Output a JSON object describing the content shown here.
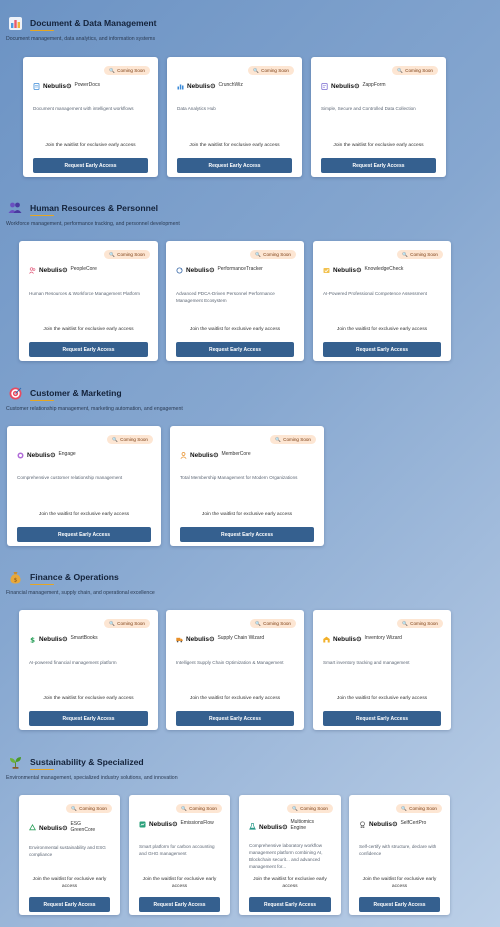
{
  "badge_label": "Coming Soon",
  "brand": "Nebulis⊙",
  "waitlist_text": "Join the waitlist for exclusive early access",
  "button_label": "Request Early Access",
  "sections": [
    {
      "title": "Document & Data Management",
      "subtitle": "Document management, data analytics, and information systems",
      "icon": "bar-chart-icon",
      "cards": [
        {
          "name": "PowerDocs",
          "icon": "document-icon",
          "description": "Document management with intelligent workflows"
        },
        {
          "name": "CrunchWiz",
          "icon": "analytics-icon",
          "description": "Data Analytics Hub"
        },
        {
          "name": "ZappForm",
          "icon": "form-icon",
          "description": "Simple, Secure and Controlled Data Collection"
        }
      ]
    },
    {
      "title": "Human Resources & Personnel",
      "subtitle": "Workforce management, performance tracking, and personnel development",
      "icon": "people-icon",
      "cards": [
        {
          "name": "PeopleCore",
          "icon": "people-icon",
          "description": "Human Resources & Workforce Management Platform"
        },
        {
          "name": "PerformanceTracker",
          "icon": "cycle-icon",
          "description": "Advanced PDCA-Driven Personnel Performance Management Ecosystem"
        },
        {
          "name": "KnowledgeCheck",
          "icon": "knowledge-icon",
          "description": "AI-Powered Professional Competence Assessment"
        }
      ]
    },
    {
      "title": "Customer & Marketing",
      "subtitle": "Customer relationship management, marketing automation, and engagement",
      "icon": "target-icon",
      "cards": [
        {
          "name": "Engage",
          "icon": "engage-icon",
          "description": "Comprehensive customer relationship management"
        },
        {
          "name": "MemberCore",
          "icon": "member-icon",
          "description": "Total Membership Management for Modern Organizations"
        }
      ]
    },
    {
      "title": "Finance & Operations",
      "subtitle": "Financial management, supply chain, and operational excellence",
      "icon": "money-bag-icon",
      "cards": [
        {
          "name": "SmartBooks",
          "icon": "dollar-icon",
          "description": "AI-powered financial management platform"
        },
        {
          "name": "Supply Chain Wizard",
          "icon": "truck-icon",
          "description": "Intelligent Supply Chain Optimization & Management"
        },
        {
          "name": "Inventory Wizard",
          "icon": "warehouse-icon",
          "description": "Smart inventory tracking and management"
        }
      ]
    },
    {
      "title": "Sustainability & Specialized",
      "subtitle": "Environmental management, specialized industry solutions, and innovation",
      "icon": "sprout-icon",
      "cards": [
        {
          "name": "ESG GreenCore",
          "icon": "recycle-icon",
          "description": "Environmental sustainability and ESG compliance"
        },
        {
          "name": "EmissionsFlow",
          "icon": "emissions-icon",
          "description": "Smart platform for carbon accounting and GHG management"
        },
        {
          "name": "Multiomics Engine",
          "icon": "lab-icon",
          "description": "Comprehensive laboratory workflow management platform combining AI, Blockchain securit... and advanced management for..."
        },
        {
          "name": "SelfCertPro",
          "icon": "certificate-icon",
          "description": "Self-certify with structure, declare with confidence"
        }
      ]
    }
  ]
}
